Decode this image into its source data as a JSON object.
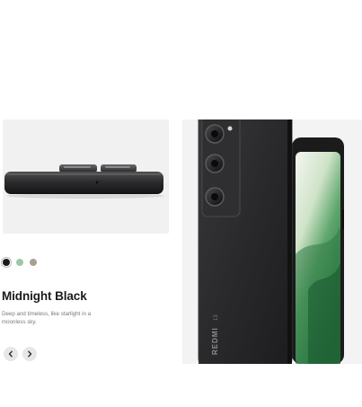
{
  "product": {
    "color_name": "Midnight Black",
    "color_description": "Deep and timeless, like starlight in a moonless sky.",
    "brand_mark": "REDMI",
    "brand_suffix": "13"
  },
  "swatches": [
    {
      "name": "Midnight Black",
      "color": "#1a1a1a",
      "selected": true
    },
    {
      "name": "Ocean Sunset Green",
      "color": "#9ec6a8",
      "selected": false
    },
    {
      "name": "Sandy Gold",
      "color": "#a99f90",
      "selected": false
    }
  ],
  "navigation": {
    "prev_icon": "chevron-left-icon",
    "next_icon": "chevron-right-icon"
  },
  "colors": {
    "panel_bg": "#f1f1f1",
    "phone_body": "#2a2a2c",
    "screen_green": "#3f8a56",
    "title_text": "#1b1b1b",
    "muted_text": "#7a7a7a",
    "button_bg": "#e7e7e7"
  }
}
